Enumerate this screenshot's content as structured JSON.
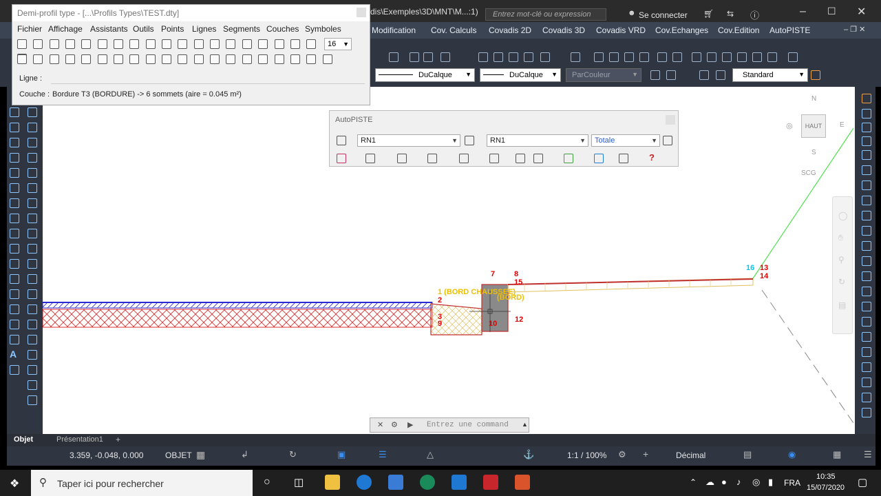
{
  "app": {
    "title_path": "dis\\Exemples\\3D\\MNT\\M...:1)",
    "search_placeholder": "Entrez mot-clé ou expression",
    "sign_in": "Se connecter"
  },
  "ribbon_tabs": [
    "Modification",
    "Cov. Calculs",
    "Covadis 2D",
    "Covadis 3D",
    "Covadis VRD",
    "Cov.Echanges",
    "Cov.Edition",
    "AutoPISTE"
  ],
  "properties": {
    "layer1": "DuCalque",
    "layer2": "DuCalque",
    "color": "ParCouleur",
    "style": "Standard"
  },
  "profil_window": {
    "title": "Demi-profil type - [...\\Profils Types\\TEST.dty]",
    "menu": [
      "Fichier",
      "Affichage",
      "Assistants",
      "Outils",
      "Points",
      "Lignes",
      "Segments",
      "Couches",
      "Symboles"
    ],
    "size_value": "16",
    "ligne_label": "Ligne :",
    "ligne_value": "",
    "couche_label": "Couche :",
    "couche_value": "Bordure T3 (BORDURE) -> 6 sommets (aire = 0.045 m²)"
  },
  "autopiste": {
    "title": "AutoPISTE",
    "combo1": "RN1",
    "combo2": "RN1",
    "combo3": "Totale"
  },
  "viewcube": {
    "north": "N",
    "top": "HAUT",
    "east": "E",
    "south": "S",
    "ucs": "SCG"
  },
  "drawing": {
    "labels": [
      "1 (BORD CHAUSSEE)",
      "2",
      "3",
      "9",
      "7",
      "8",
      "15",
      "(BORD)",
      "12",
      "10",
      "13",
      "14",
      "16"
    ]
  },
  "command": {
    "placeholder": "Entrez une command"
  },
  "layout_tabs": [
    "Objet",
    "Présentation1",
    "+"
  ],
  "status": {
    "coords": "3.359, -0.048, 0.000",
    "mode": "OBJET",
    "scale": "1:1 / 100%",
    "units": "Décimal"
  },
  "taskbar": {
    "search": "Taper ici pour rechercher",
    "lang": "FRA",
    "time": "10:35",
    "date": "15/07/2020"
  },
  "colors": {
    "canvas_bg": "#ffffff",
    "dark_ui": "#2f3642",
    "hatch_red": "#e03030",
    "blue_line": "#2b2bd6",
    "green_line": "#50e050",
    "label_red": "#e00000",
    "label_cyan": "#00c8f0",
    "label_yellow": "#f0c000"
  }
}
